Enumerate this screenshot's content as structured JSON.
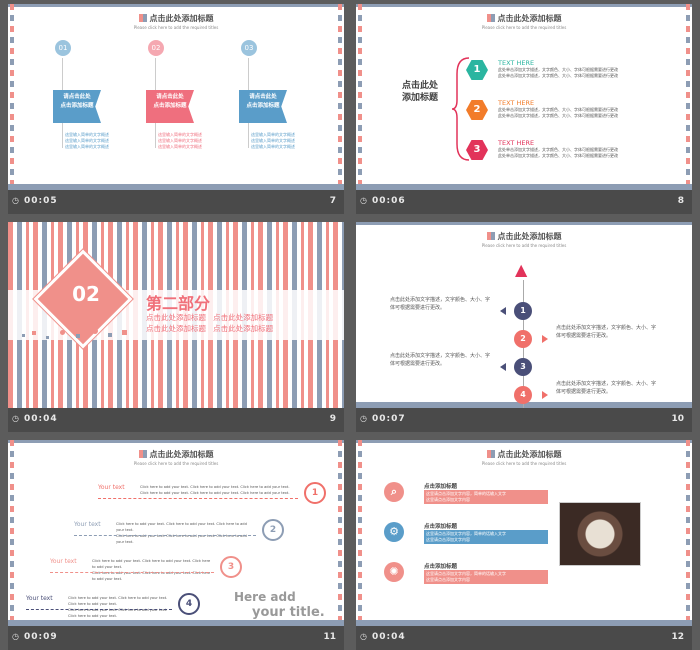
{
  "slides": [
    {
      "time": "00:05",
      "num": "7",
      "title": "点击此处添加标题",
      "subtitle": "Please click here to add the required titles",
      "flags": [
        {
          "n": "01",
          "text": "请点击此处\n点击添加标题",
          "desc": "這里输入简单的文字概述\n這里输入简单的文字概述\n這里输入简单的文字概述",
          "color": "#5a9dc9"
        },
        {
          "n": "02",
          "text": "请点击此处\n点击添加标题",
          "desc": "這里输入简单的文字概述\n這里输入简单的文字概述\n這里输入简单的文字概述",
          "color": "#ef6f7e"
        },
        {
          "n": "03",
          "text": "请点击此处\n点击添加标题",
          "desc": "這里输入简单的文字概述\n這里输入简单的文字概述\n這里输入简单的文字概述",
          "color": "#5a9dc9"
        }
      ]
    },
    {
      "time": "00:06",
      "num": "8",
      "title": "点击此处添加标题",
      "subtitle": "Please click here to add the required titles",
      "left_label": "点击此处\n添加标题",
      "items": [
        {
          "n": "1",
          "head": "TEXT HERE",
          "body": "此处单击添加文字描述，文字颜色、大小、字体可根据需要进行更改\n此处单击添加文字描述，文字颜色、大小、字体可根据需要进行更改",
          "color": "#2bb5a0"
        },
        {
          "n": "2",
          "head": "TEXT HERE",
          "body": "此处单击添加文字描述，文字颜色、大小、字体可根据需要进行更改\n此处单击添加文字描述，文字颜色、大小、字体可根据需要进行更改",
          "color": "#f27c2a"
        },
        {
          "n": "3",
          "head": "TEXT HERE",
          "body": "此处单击添加文字描述，文字颜色、大小、字体可根据需要进行更改\n此处单击添加文字描述，文字颜色、大小、字体可根据需要进行更改",
          "color": "#e2335a"
        }
      ]
    },
    {
      "time": "00:04",
      "num": "9",
      "badge": "02",
      "title": "第二部分",
      "lines": [
        "点击此处添加标题",
        "点击此处添加标题",
        "点击此处添加标题",
        "点击此处添加标题"
      ]
    },
    {
      "time": "00:07",
      "num": "10",
      "title": "点击此处添加标题",
      "subtitle": "Please click here to add the required titles",
      "steps": [
        {
          "n": "1",
          "text": "点击此处添加文字描述，文字颜色、大小、字体可根据需要进行更改。",
          "side": "left"
        },
        {
          "n": "2",
          "text": "点击此处添加文字描述，文字颜色、大小、字体可根据需要进行更改。",
          "side": "right"
        },
        {
          "n": "3",
          "text": "点击此处添加文字描述，文字颜色、大小、字体可根据需要进行更改。",
          "side": "left"
        },
        {
          "n": "4",
          "text": "点击此处添加文字描述，文字颜色、大小、字体可根据需要进行更改。",
          "side": "right"
        }
      ]
    },
    {
      "time": "00:09",
      "num": "11",
      "title": "点击此处添加标题",
      "subtitle": "Please click here to add the required titles",
      "stairs": [
        {
          "n": "1",
          "label": "Your text",
          "body": "Click here to add your text. Click here to add your text. Click here to add your text.\nClick here to add your text. Click here to add your text. Click here to add your text."
        },
        {
          "n": "2",
          "label": "Your text",
          "body": "Click here to add your text. Click here to add your text. Click here to add your text.\nClick here to add your text. Click here to add your text. Click here to add your text."
        },
        {
          "n": "3",
          "label": "Your text",
          "body": "Click here to add your text. Click here to add your text. Click here to add your text.\nClick here to add your text. Click here to add your text. Click here to add your text."
        },
        {
          "n": "4",
          "label": "Your text",
          "body": "Click here to add your text. Click here to add your text. Click here to add your text.\nClick here to add your text. Click here to add your text. Click here to add your text."
        }
      ],
      "big1": "Here add",
      "big2": "your title."
    },
    {
      "time": "00:04",
      "num": "12",
      "title": "点击此处添加标题",
      "subtitle": "Please click here to add the required titles",
      "rows": [
        {
          "head": "点击添加标题",
          "body": "这里请点击添加文字内容，简单的话输入文字\n这里请点击添加文字内容",
          "icon": "search-icon",
          "color": "#f0908a"
        },
        {
          "head": "点击添加标题",
          "body": "这里请点击添加文字内容，简单的话输入文字\n这里请点击添加文字内容",
          "icon": "gear-icon",
          "color": "#5a9dc9"
        },
        {
          "head": "点击添加标题",
          "body": "这里请点击添加文字内容，简单的话输入文字\n这里请点击添加文字内容",
          "icon": "bulb-icon",
          "color": "#f0908a"
        }
      ]
    }
  ]
}
